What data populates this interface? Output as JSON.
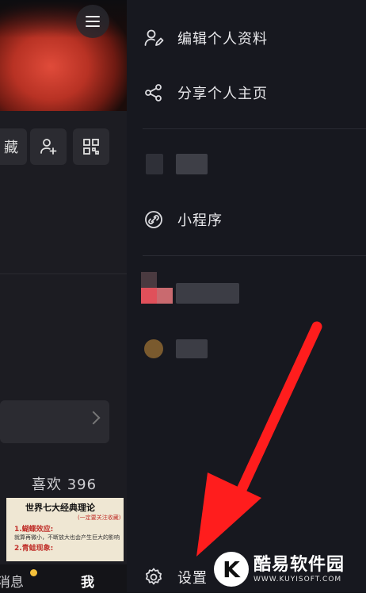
{
  "left_panel": {
    "chip_fav_label": "藏",
    "likes_text": "喜欢 396",
    "thumbnail": {
      "title": "世界七大经典理论",
      "subtitle": "(一定要关注收藏)",
      "item1": "1.蝴蝶效应:",
      "item1_desc": "就算再微小，不断放大也会产生巨大的影响",
      "item2": "2.青蛙现象:"
    },
    "tabbar": {
      "messages": "消息",
      "me": "我"
    }
  },
  "drawer": {
    "items": [
      {
        "label": "编辑个人资料",
        "icon": "edit-profile-icon"
      },
      {
        "label": "分享个人主页",
        "icon": "share-icon"
      },
      {
        "label": "小程序",
        "icon": "mini-program-icon"
      },
      {
        "label": "设置",
        "icon": "settings-gear-icon"
      }
    ]
  },
  "colors": {
    "drawer_bg": "#17181f",
    "arrow": "#ff1d1d",
    "accent_dot": "#f5c13b"
  },
  "watermark": {
    "cn": "酷易软件园",
    "en": "WWW.KUYISOFT.COM",
    "logo_letter": "K"
  }
}
